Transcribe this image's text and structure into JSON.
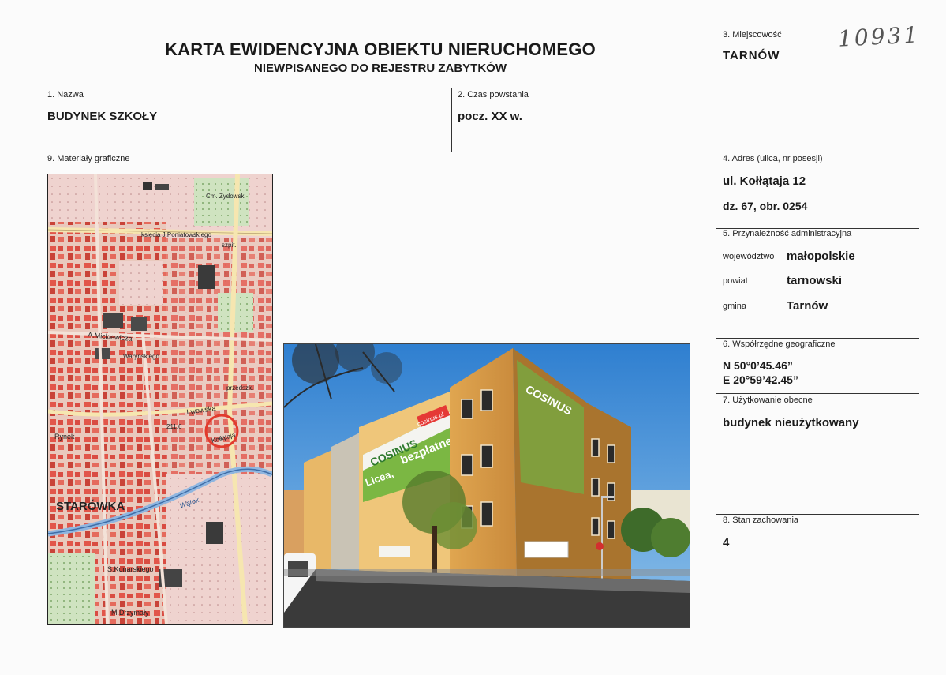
{
  "header": {
    "title": "KARTA EWIDENCYJNA OBIEKTU NIERUCHOMEGO",
    "subtitle": "NIEWPISANEGO DO REJESTRU ZABYTKÓW",
    "handwritten_number": "10931"
  },
  "fields": {
    "miejscowosc": {
      "label": "3. Miejscowość",
      "value": "TARNÓW"
    },
    "nazwa": {
      "label": "1. Nazwa",
      "value": "BUDYNEK SZKOŁY"
    },
    "czas": {
      "label": "2. Czas powstania",
      "value": "pocz. XX w."
    },
    "materialy": {
      "label": "9. Materiały graficzne"
    },
    "adres": {
      "label": "4. Adres (ulica, nr posesji)",
      "line1": "ul. Kołłątaja 12",
      "line2": "dz. 67, obr. 0254"
    },
    "przynaleznosc": {
      "label": "5. Przynależność administracyjna",
      "wojewodztwo_label": "województwo",
      "wojewodztwo": "małopolskie",
      "powiat_label": "powiat",
      "powiat": "tarnowski",
      "gmina_label": "gmina",
      "gmina": "Tarnów"
    },
    "wspolrzedne": {
      "label": "6. Współrzędne geograficzne",
      "n": "N 50°0’45.46”",
      "e": "E 20°59’42.45”"
    },
    "uzytkowanie": {
      "label": "7. Użytkowanie obecne",
      "value": "budynek nieużytkowany"
    },
    "stan": {
      "label": "8. Stan zachowania",
      "value": "4"
    }
  },
  "map": {
    "labels": {
      "starowka": "STARÓWKA",
      "poniatowskiego": "księcia J.Poniatowskiego",
      "mickiewicza": "A.Mickiewicza",
      "warynskiego": "Waryńskiego",
      "lwowska": "Lwowska",
      "kollataja": "Kołłątaja",
      "rynek": "Rynek",
      "watok": "Wątok",
      "konarskiego": "S.Konarskiego",
      "drzymaly": "M.Drzymały",
      "cm_zydowski": "Cm. Żydowski",
      "szpit": "szpit.",
      "przedszk": "przedszk.",
      "height": "211,6"
    }
  },
  "photo": {
    "sign1": "COSINUS",
    "sign2": "bezpłatne!",
    "sign3": "Licea,",
    "sign4": "cosinus.pl"
  }
}
